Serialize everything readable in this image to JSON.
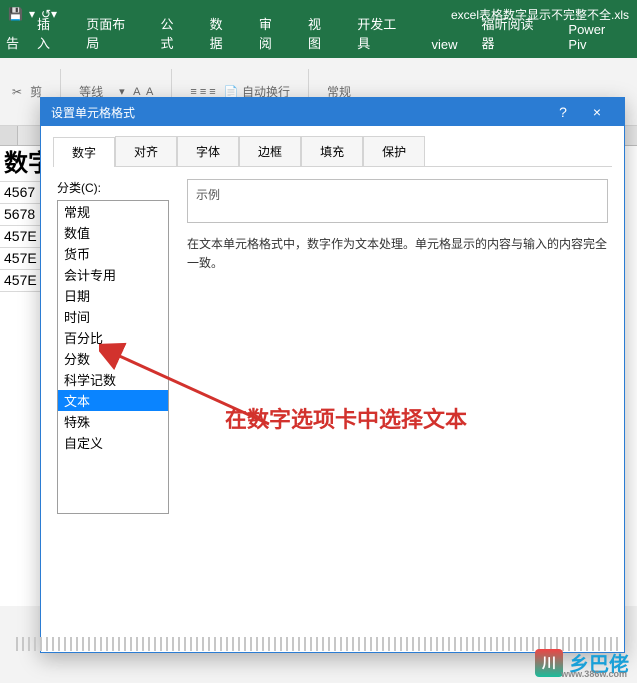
{
  "title_bar": {
    "doc_title": "excel表格数字显示不完整不全.xls"
  },
  "ribbon": {
    "tabs": [
      "插入",
      "页面布局",
      "公式",
      "数据",
      "审阅",
      "视图",
      "开发工具",
      "view",
      "福昕阅读器",
      "Power Piv"
    ],
    "font_name": "等线",
    "wrap_label": "自动换行",
    "style_label": "常规"
  },
  "clipboard_label": "剪",
  "sheet": {
    "header": "数字",
    "rows": [
      "4567",
      "5678",
      "457E",
      "457E",
      "457E"
    ]
  },
  "dialog": {
    "title": "设置单元格格式",
    "tabs": [
      "数字",
      "对齐",
      "字体",
      "边框",
      "填充",
      "保护"
    ],
    "category_label": "分类(C):",
    "categories": [
      "常规",
      "数值",
      "货币",
      "会计专用",
      "日期",
      "时间",
      "百分比",
      "分数",
      "科学记数",
      "文本",
      "特殊",
      "自定义"
    ],
    "selected_category": "文本",
    "sample_label": "示例",
    "description": "在文本单元格格式中，数字作为文本处理。单元格显示的内容与输入的内容完全一致。",
    "help": "?",
    "close": "×"
  },
  "annotation": "在数字选项卡中选择文本",
  "watermark": {
    "text": "乡巴佬",
    "url": "www.386w.com"
  }
}
